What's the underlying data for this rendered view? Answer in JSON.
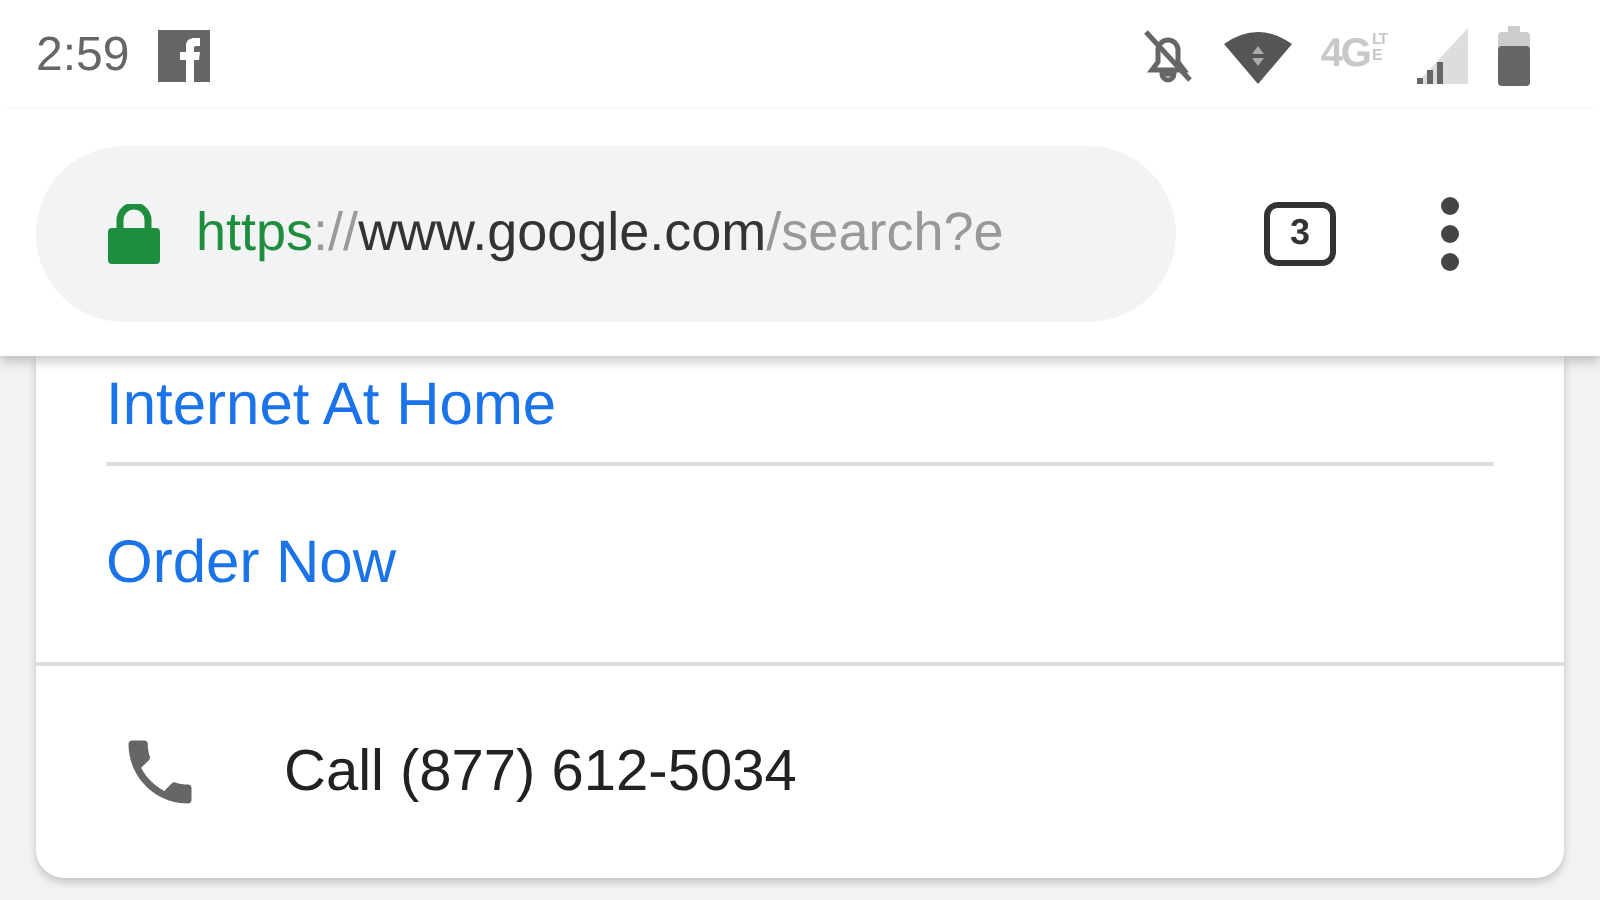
{
  "status_bar": {
    "time": "2:59",
    "network": "4G",
    "network_sub": "LTE"
  },
  "toolbar": {
    "url": {
      "scheme": "https",
      "separator": "://",
      "host": "www.google.com",
      "path": "/search?e"
    },
    "secure": true,
    "tab_count": "3"
  },
  "card": {
    "links": [
      {
        "label": "Internet At Home"
      },
      {
        "label": "Order Now"
      }
    ],
    "call": {
      "label": "Call (877) 612-5034"
    }
  }
}
